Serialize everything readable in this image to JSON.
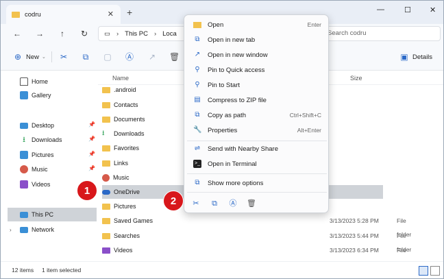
{
  "window": {
    "tab_title": "codru",
    "tab_close": "✕",
    "new_tab": "+"
  },
  "window_controls": {
    "minimize": "—",
    "maximize": "☐",
    "close": "✕"
  },
  "address": {
    "root_glyph": "▭",
    "crumbs": [
      "This PC",
      "Loca"
    ],
    "search_placeholder": "Search codru"
  },
  "nav": {
    "back": "←",
    "forward": "→",
    "up": "↑",
    "refresh": "↻"
  },
  "toolbar": {
    "new_label": "New",
    "details_label": "Details"
  },
  "sidebar": {
    "home": "Home",
    "gallery": "Gallery",
    "desktop": "Desktop",
    "downloads": "Downloads",
    "pictures": "Pictures",
    "music": "Music",
    "videos": "Videos",
    "this_pc": "This PC",
    "network": "Network"
  },
  "columns": {
    "name": "Name",
    "size": "Size"
  },
  "files": [
    {
      "name": ".android",
      "date": "",
      "type": ""
    },
    {
      "name": "Contacts",
      "date": "",
      "type": ""
    },
    {
      "name": "Documents",
      "date": "",
      "type": ""
    },
    {
      "name": "Downloads",
      "date": "",
      "type": ""
    },
    {
      "name": "Favorites",
      "date": "",
      "type": ""
    },
    {
      "name": "Links",
      "date": "",
      "type": ""
    },
    {
      "name": "Music",
      "date": "",
      "type": ""
    },
    {
      "name": "OneDrive",
      "date": "",
      "type": ""
    },
    {
      "name": "Pictures",
      "date": "",
      "type": ""
    },
    {
      "name": "Saved Games",
      "date": "3/13/2023 5:28 PM",
      "type": "File folder"
    },
    {
      "name": "Searches",
      "date": "3/13/2023 5:44 PM",
      "type": "File folder"
    },
    {
      "name": "Videos",
      "date": "3/13/2023 6:34 PM",
      "type": "File folder"
    }
  ],
  "status": {
    "item_count": "12 items",
    "selected": "1 item selected"
  },
  "context_menu": {
    "open": "Open",
    "open_shortcut": "Enter",
    "open_new_tab": "Open in new tab",
    "open_new_window": "Open in new window",
    "pin_quick_access": "Pin to Quick access",
    "pin_start": "Pin to Start",
    "compress_zip": "Compress to ZIP file",
    "copy_path": "Copy as path",
    "copy_path_shortcut": "Ctrl+Shift+C",
    "properties": "Properties",
    "properties_shortcut": "Alt+Enter",
    "nearby_share": "Send with Nearby Share",
    "open_terminal": "Open in Terminal",
    "show_more": "Show more options"
  },
  "callouts": {
    "one": "1",
    "two": "2"
  },
  "colors": {
    "accent": "#2b69c7",
    "folder": "#f2c24e",
    "callout": "#d8171b",
    "selection": "#cfd3d8"
  }
}
